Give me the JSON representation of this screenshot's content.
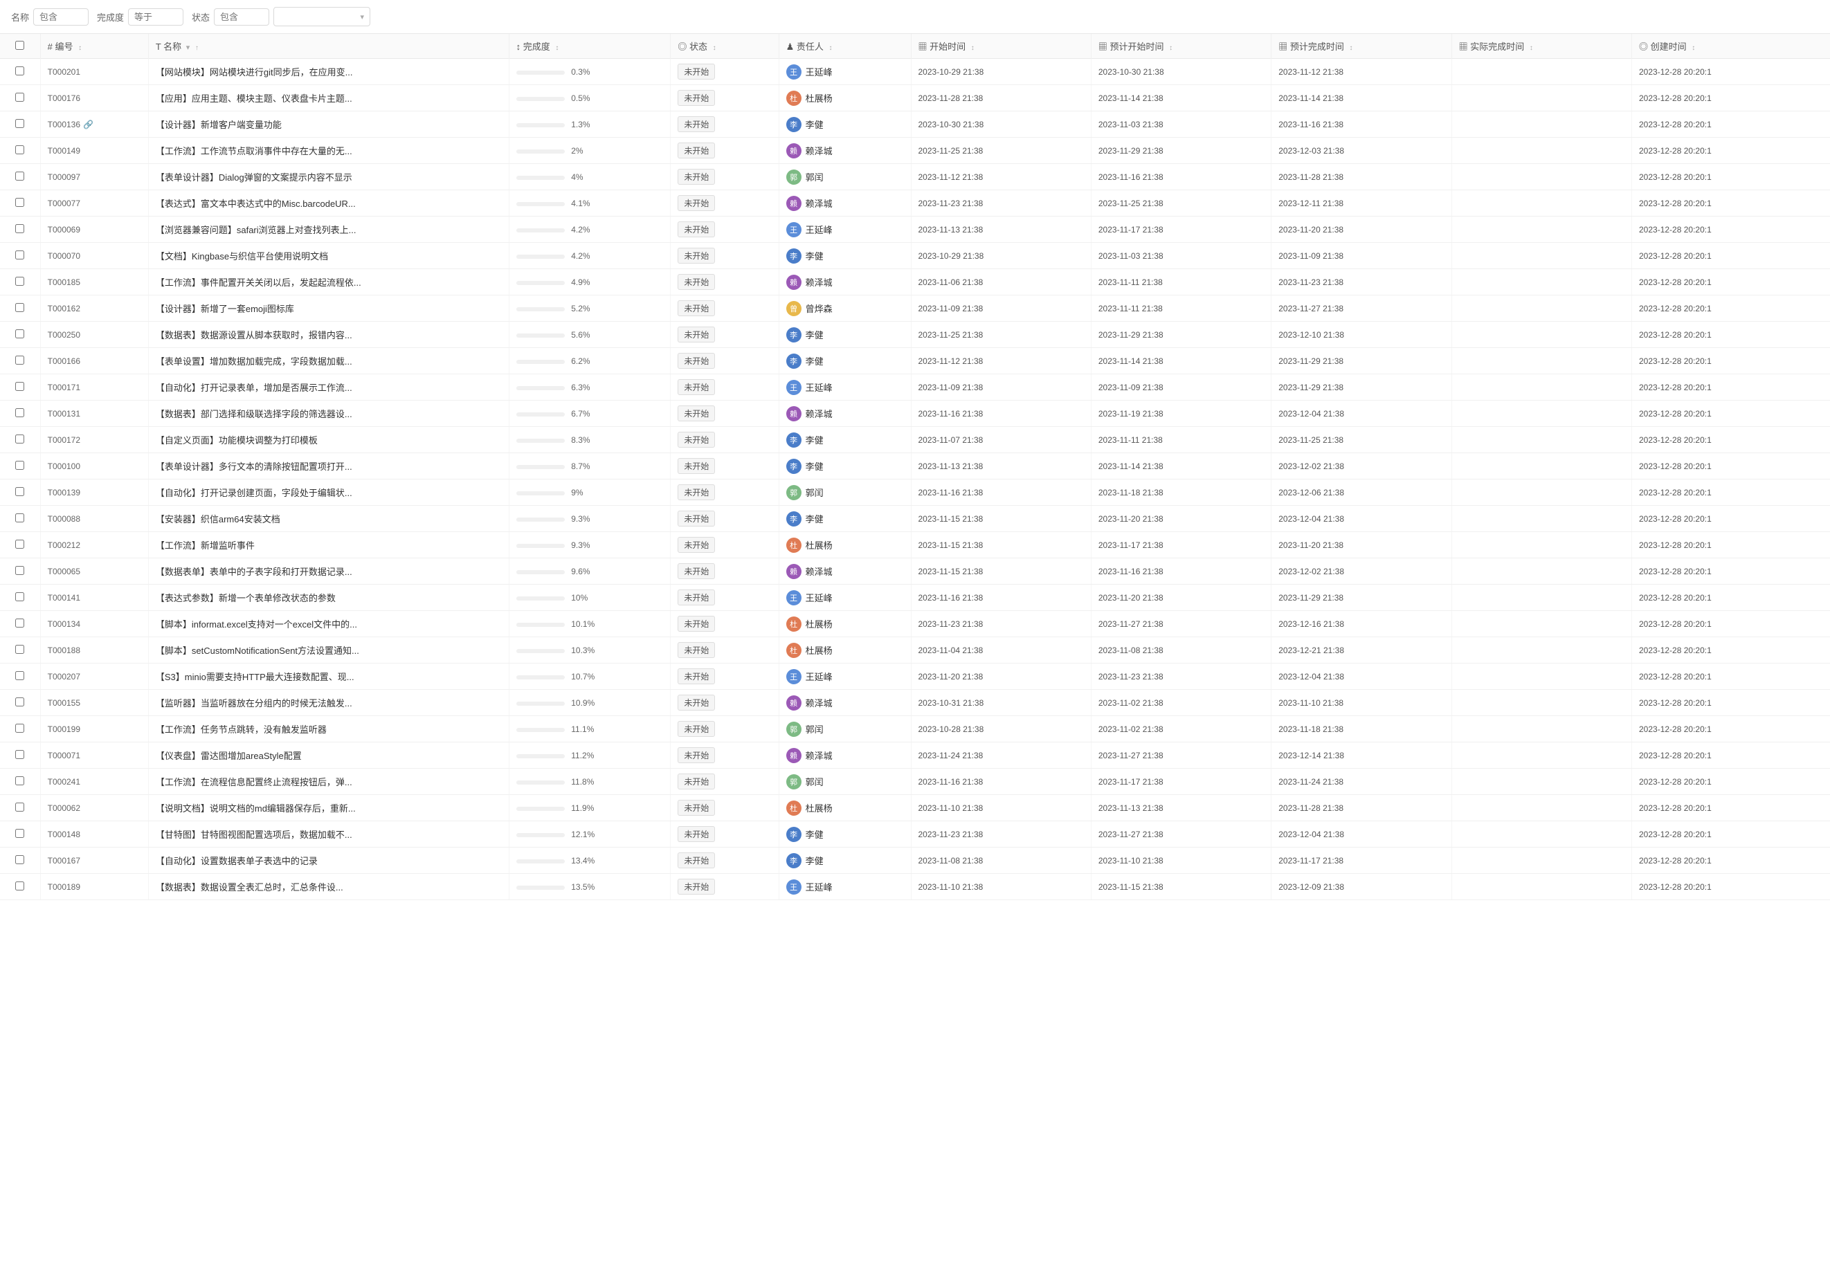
{
  "filters": {
    "title_label": "名称",
    "title_placeholder": "包含",
    "progress_label": "完成度",
    "progress_placeholder": "等于",
    "status_label": "状态",
    "status_placeholder": "包含",
    "status_dropdown_placeholder": ""
  },
  "columns": [
    {
      "key": "checkbox",
      "label": "",
      "class": "col-num"
    },
    {
      "key": "id",
      "label": "# 编号",
      "class": "col-id",
      "sortable": true
    },
    {
      "key": "name",
      "label": "T 名称",
      "class": "col-name",
      "sortable": true,
      "filterable": true
    },
    {
      "key": "progress",
      "label": "↕ 完成度",
      "class": "col-progress",
      "sortable": true
    },
    {
      "key": "status",
      "label": "◎ 状态",
      "class": "col-status",
      "sortable": true
    },
    {
      "key": "assignee",
      "label": "♟ 责任人",
      "class": "col-assignee",
      "sortable": true
    },
    {
      "key": "start",
      "label": "▦ 开始时间",
      "class": "col-start",
      "sortable": true
    },
    {
      "key": "plan_start",
      "label": "▦ 预计开始时间",
      "class": "col-plan-start",
      "sortable": true
    },
    {
      "key": "plan_end",
      "label": "▦ 预计完成时间",
      "class": "col-plan-end",
      "sortable": true
    },
    {
      "key": "actual_end",
      "label": "▦ 实际完成时间",
      "class": "col-actual-end",
      "sortable": true
    },
    {
      "key": "created",
      "label": "◎ 创建时间",
      "class": "col-created",
      "sortable": true
    }
  ],
  "rows": [
    {
      "id": "T000201",
      "name": "【网站模块】网站模块进行git同步后，在应用变...",
      "progress_val": 0.3,
      "progress_text": "0.3%",
      "status": "未开始",
      "assignee": "王延峰",
      "avatar_color": "#5b8dd9",
      "start": "2023-10-29 21:38",
      "plan_start": "2023-10-30 21:38",
      "plan_end": "2023-11-12 21:38",
      "actual_end": "",
      "created": "2023-12-28 20:20:1"
    },
    {
      "id": "T000176",
      "name": "【应用】应用主题、模块主题、仪表盘卡片主题...",
      "progress_val": 0.5,
      "progress_text": "0.5%",
      "status": "未开始",
      "assignee": "杜展杨",
      "avatar_color": "#e07b54",
      "start": "2023-11-28 21:38",
      "plan_start": "2023-11-14 21:38",
      "plan_end": "2023-11-14 21:38",
      "actual_end": "",
      "created": "2023-12-28 20:20:1"
    },
    {
      "id": "T000136",
      "name": "【设计器】新增客户端变量功能",
      "progress_val": 1.3,
      "progress_text": "1.3%",
      "status": "未开始",
      "assignee": "李健",
      "avatar_color": "#5b8dd9",
      "start": "2023-10-30 21:38",
      "plan_start": "2023-11-03 21:38",
      "plan_end": "2023-11-16 21:38",
      "actual_end": "",
      "created": "2023-12-28 20:20:1",
      "has_link": true
    },
    {
      "id": "T000149",
      "name": "【工作流】工作流节点取消事件中存在大量的无...",
      "progress_val": 2,
      "progress_text": "2%",
      "status": "未开始",
      "assignee": "赖泽城",
      "avatar_color": "#9b59b6",
      "start": "2023-11-25 21:38",
      "plan_start": "2023-11-29 21:38",
      "plan_end": "2023-12-03 21:38",
      "actual_end": "",
      "created": "2023-12-28 20:20:1"
    },
    {
      "id": "T000097",
      "name": "【表单设计器】Dialog弹窗的文案提示内容不显示",
      "progress_val": 4,
      "progress_text": "4%",
      "status": "未开始",
      "assignee": "郭闰",
      "avatar_color": "#7dba84",
      "start": "2023-11-12 21:38",
      "plan_start": "2023-11-16 21:38",
      "plan_end": "2023-11-28 21:38",
      "actual_end": "",
      "created": "2023-12-28 20:20:1"
    },
    {
      "id": "T000077",
      "name": "【表达式】富文本中表达式中的Misc.barcodeUR...",
      "progress_val": 4.1,
      "progress_text": "4.1%",
      "status": "未开始",
      "assignee": "赖泽城",
      "avatar_color": "#9b59b6",
      "start": "2023-11-23 21:38",
      "plan_start": "2023-11-25 21:38",
      "plan_end": "2023-12-11 21:38",
      "actual_end": "",
      "created": "2023-12-28 20:20:1"
    },
    {
      "id": "T000069",
      "name": "【浏览器兼容问题】safari浏览器上对查找列表上...",
      "progress_val": 4.2,
      "progress_text": "4.2%",
      "status": "未开始",
      "assignee": "王延峰",
      "avatar_color": "#5b8dd9",
      "start": "2023-11-13 21:38",
      "plan_start": "2023-11-17 21:38",
      "plan_end": "2023-11-20 21:38",
      "actual_end": "",
      "created": "2023-12-28 20:20:1"
    },
    {
      "id": "T000070",
      "name": "【文档】Kingbase与织信平台使用说明文档",
      "progress_val": 4.2,
      "progress_text": "4.2%",
      "status": "未开始",
      "assignee": "李健",
      "avatar_color": "#5b8dd9",
      "start": "2023-10-29 21:38",
      "plan_start": "2023-11-03 21:38",
      "plan_end": "2023-11-09 21:38",
      "actual_end": "",
      "created": "2023-12-28 20:20:1"
    },
    {
      "id": "T000185",
      "name": "【工作流】事件配置开关关闭以后，发起起流程依...",
      "progress_val": 4.9,
      "progress_text": "4.9%",
      "status": "未开始",
      "assignee": "赖泽城",
      "avatar_color": "#9b59b6",
      "start": "2023-11-06 21:38",
      "plan_start": "2023-11-11 21:38",
      "plan_end": "2023-11-23 21:38",
      "actual_end": "",
      "created": "2023-12-28 20:20:1"
    },
    {
      "id": "T000162",
      "name": "【设计器】新增了一套emoji图标库",
      "progress_val": 5.2,
      "progress_text": "5.2%",
      "status": "未开始",
      "assignee": "曾烨森",
      "avatar_color": "#e8b84b",
      "start": "2023-11-09 21:38",
      "plan_start": "2023-11-11 21:38",
      "plan_end": "2023-11-27 21:38",
      "actual_end": "",
      "created": "2023-12-28 20:20:1"
    },
    {
      "id": "T000250",
      "name": "【数据表】数据源设置从脚本获取时，报错内容...",
      "progress_val": 5.6,
      "progress_text": "5.6%",
      "status": "未开始",
      "assignee": "李健",
      "avatar_color": "#5b8dd9",
      "start": "2023-11-25 21:38",
      "plan_start": "2023-11-29 21:38",
      "plan_end": "2023-12-10 21:38",
      "actual_end": "",
      "created": "2023-12-28 20:20:1"
    },
    {
      "id": "T000166",
      "name": "【表单设置】增加数据加载完成，字段数据加载...",
      "progress_val": 6.2,
      "progress_text": "6.2%",
      "status": "未开始",
      "assignee": "李健",
      "avatar_color": "#5b8dd9",
      "start": "2023-11-12 21:38",
      "plan_start": "2023-11-14 21:38",
      "plan_end": "2023-11-29 21:38",
      "actual_end": "",
      "created": "2023-12-28 20:20:1"
    },
    {
      "id": "T000171",
      "name": "【自动化】打开记录表单，增加是否展示工作流...",
      "progress_val": 6.3,
      "progress_text": "6.3%",
      "status": "未开始",
      "assignee": "王延峰",
      "avatar_color": "#5b8dd9",
      "start": "2023-11-09 21:38",
      "plan_start": "2023-11-09 21:38",
      "plan_end": "2023-11-29 21:38",
      "actual_end": "",
      "created": "2023-12-28 20:20:1"
    },
    {
      "id": "T000131",
      "name": "【数据表】部门选择和级联选择字段的筛选器设...",
      "progress_val": 6.7,
      "progress_text": "6.7%",
      "status": "未开始",
      "assignee": "赖泽城",
      "avatar_color": "#9b59b6",
      "start": "2023-11-16 21:38",
      "plan_start": "2023-11-19 21:38",
      "plan_end": "2023-12-04 21:38",
      "actual_end": "",
      "created": "2023-12-28 20:20:1"
    },
    {
      "id": "T000172",
      "name": "【自定义页面】功能模块调整为打印模板",
      "progress_val": 8.3,
      "progress_text": "8.3%",
      "status": "未开始",
      "assignee": "李健",
      "avatar_color": "#5b8dd9",
      "start": "2023-11-07 21:38",
      "plan_start": "2023-11-11 21:38",
      "plan_end": "2023-11-25 21:38",
      "actual_end": "",
      "created": "2023-12-28 20:20:1"
    },
    {
      "id": "T000100",
      "name": "【表单设计器】多行文本的清除按钮配置项打开...",
      "progress_val": 8.7,
      "progress_text": "8.7%",
      "status": "未开始",
      "assignee": "李健",
      "avatar_color": "#5b8dd9",
      "start": "2023-11-13 21:38",
      "plan_start": "2023-11-14 21:38",
      "plan_end": "2023-12-02 21:38",
      "actual_end": "",
      "created": "2023-12-28 20:20:1"
    },
    {
      "id": "T000139",
      "name": "【自动化】打开记录创建页面，字段处于编辑状...",
      "progress_val": 9,
      "progress_text": "9%",
      "status": "未开始",
      "assignee": "郭闰",
      "avatar_color": "#7dba84",
      "start": "2023-11-16 21:38",
      "plan_start": "2023-11-18 21:38",
      "plan_end": "2023-12-06 21:38",
      "actual_end": "",
      "created": "2023-12-28 20:20:1"
    },
    {
      "id": "T000088",
      "name": "【安装器】织信arm64安装文档",
      "progress_val": 9.3,
      "progress_text": "9.3%",
      "status": "未开始",
      "assignee": "李健",
      "avatar_color": "#5b8dd9",
      "start": "2023-11-15 21:38",
      "plan_start": "2023-11-20 21:38",
      "plan_end": "2023-12-04 21:38",
      "actual_end": "",
      "created": "2023-12-28 20:20:1"
    },
    {
      "id": "T000212",
      "name": "【工作流】新增监听事件",
      "progress_val": 9.3,
      "progress_text": "9.3%",
      "status": "未开始",
      "assignee": "杜展杨",
      "avatar_color": "#e07b54",
      "start": "2023-11-15 21:38",
      "plan_start": "2023-11-17 21:38",
      "plan_end": "2023-11-20 21:38",
      "actual_end": "",
      "created": "2023-12-28 20:20:1"
    },
    {
      "id": "T000065",
      "name": "【数据表单】表单中的子表字段和打开数据记录...",
      "progress_val": 9.6,
      "progress_text": "9.6%",
      "status": "未开始",
      "assignee": "赖泽城",
      "avatar_color": "#9b59b6",
      "start": "2023-11-15 21:38",
      "plan_start": "2023-11-16 21:38",
      "plan_end": "2023-12-02 21:38",
      "actual_end": "",
      "created": "2023-12-28 20:20:1"
    },
    {
      "id": "T000141",
      "name": "【表达式参数】新增一个表单修改状态的参数",
      "progress_val": 10,
      "progress_text": "10%",
      "status": "未开始",
      "assignee": "王延峰",
      "avatar_color": "#5b8dd9",
      "start": "2023-11-16 21:38",
      "plan_start": "2023-11-20 21:38",
      "plan_end": "2023-11-29 21:38",
      "actual_end": "",
      "created": "2023-12-28 20:20:1"
    },
    {
      "id": "T000134",
      "name": "【脚本】informat.excel支持对一个excel文件中的...",
      "progress_val": 10.1,
      "progress_text": "10.1%",
      "status": "未开始",
      "assignee": "杜展杨",
      "avatar_color": "#e07b54",
      "start": "2023-11-23 21:38",
      "plan_start": "2023-11-27 21:38",
      "plan_end": "2023-12-16 21:38",
      "actual_end": "",
      "created": "2023-12-28 20:20:1"
    },
    {
      "id": "T000188",
      "name": "【脚本】setCustomNotificationSent方法设置通知...",
      "progress_val": 10.3,
      "progress_text": "10.3%",
      "status": "未开始",
      "assignee": "杜展杨",
      "avatar_color": "#e07b54",
      "start": "2023-11-04 21:38",
      "plan_start": "2023-11-08 21:38",
      "plan_end": "2023-12-21 21:38",
      "actual_end": "",
      "created": "2023-12-28 20:20:1"
    },
    {
      "id": "T000207",
      "name": "【S3】minio需要支持HTTP最大连接数配置、现...",
      "progress_val": 10.7,
      "progress_text": "10.7%",
      "status": "未开始",
      "assignee": "王延峰",
      "avatar_color": "#5b8dd9",
      "start": "2023-11-20 21:38",
      "plan_start": "2023-11-23 21:38",
      "plan_end": "2023-12-04 21:38",
      "actual_end": "",
      "created": "2023-12-28 20:20:1"
    },
    {
      "id": "T000155",
      "name": "【监听器】当监听器放在分组内的时候无法触发...",
      "progress_val": 10.9,
      "progress_text": "10.9%",
      "status": "未开始",
      "assignee": "赖泽城",
      "avatar_color": "#9b59b6",
      "start": "2023-10-31 21:38",
      "plan_start": "2023-11-02 21:38",
      "plan_end": "2023-11-10 21:38",
      "actual_end": "",
      "created": "2023-12-28 20:20:1"
    },
    {
      "id": "T000199",
      "name": "【工作流】任务节点跳转，没有触发监听器",
      "progress_val": 11.1,
      "progress_text": "11.1%",
      "status": "未开始",
      "assignee": "郭闰",
      "avatar_color": "#7dba84",
      "start": "2023-10-28 21:38",
      "plan_start": "2023-11-02 21:38",
      "plan_end": "2023-11-18 21:38",
      "actual_end": "",
      "created": "2023-12-28 20:20:1"
    },
    {
      "id": "T000071",
      "name": "【仪表盘】雷达图增加areaStyle配置",
      "progress_val": 11.2,
      "progress_text": "11.2%",
      "status": "未开始",
      "assignee": "赖泽城",
      "avatar_color": "#9b59b6",
      "start": "2023-11-24 21:38",
      "plan_start": "2023-11-27 21:38",
      "plan_end": "2023-12-14 21:38",
      "actual_end": "",
      "created": "2023-12-28 20:20:1"
    },
    {
      "id": "T000241",
      "name": "【工作流】在流程信息配置终止流程按钮后，弹...",
      "progress_val": 11.8,
      "progress_text": "11.8%",
      "status": "未开始",
      "assignee": "郭闰",
      "avatar_color": "#7dba84",
      "start": "2023-11-16 21:38",
      "plan_start": "2023-11-17 21:38",
      "plan_end": "2023-11-24 21:38",
      "actual_end": "",
      "created": "2023-12-28 20:20:1"
    },
    {
      "id": "T000062",
      "name": "【说明文档】说明文档的md编辑器保存后，重新...",
      "progress_val": 11.9,
      "progress_text": "11.9%",
      "status": "未开始",
      "assignee": "杜展杨",
      "avatar_color": "#e07b54",
      "start": "2023-11-10 21:38",
      "plan_start": "2023-11-13 21:38",
      "plan_end": "2023-11-28 21:38",
      "actual_end": "",
      "created": "2023-12-28 20:20:1"
    },
    {
      "id": "T000148",
      "name": "【甘特图】甘特图视图配置选项后，数据加载不...",
      "progress_val": 12.1,
      "progress_text": "12.1%",
      "status": "未开始",
      "assignee": "李健",
      "avatar_color": "#5b8dd9",
      "start": "2023-11-23 21:38",
      "plan_start": "2023-11-27 21:38",
      "plan_end": "2023-12-04 21:38",
      "actual_end": "",
      "created": "2023-12-28 20:20:1"
    },
    {
      "id": "T000167",
      "name": "【自动化】设置数据表单子表选中的记录",
      "progress_val": 13.4,
      "progress_text": "13.4%",
      "status": "未开始",
      "assignee": "李健",
      "avatar_color": "#5b8dd9",
      "start": "2023-11-08 21:38",
      "plan_start": "2023-11-10 21:38",
      "plan_end": "2023-11-17 21:38",
      "actual_end": "",
      "created": "2023-12-28 20:20:1"
    },
    {
      "id": "T000189",
      "name": "【数据表】数据设置全表汇总时，汇总条件设...",
      "progress_val": 13.5,
      "progress_text": "13.5%",
      "status": "未开始",
      "assignee": "王延峰",
      "avatar_color": "#5b8dd9",
      "start": "2023-11-10 21:38",
      "plan_start": "2023-11-15 21:38",
      "plan_end": "2023-12-09 21:38",
      "actual_end": "",
      "created": "2023-12-28 20:20:1"
    }
  ],
  "avatars": {
    "王延峰": {
      "initials": "王",
      "color": "#5b8dd9"
    },
    "杜展杨": {
      "initials": "杜",
      "color": "#e07b54"
    },
    "李健": {
      "initials": "李",
      "color": "#5b8dd9"
    },
    "赖泽城": {
      "initials": "赖",
      "color": "#9b59b6"
    },
    "郭闰": {
      "initials": "郭",
      "color": "#7dba84"
    },
    "曾烨森": {
      "initials": "曾",
      "color": "#e8b84b"
    }
  }
}
